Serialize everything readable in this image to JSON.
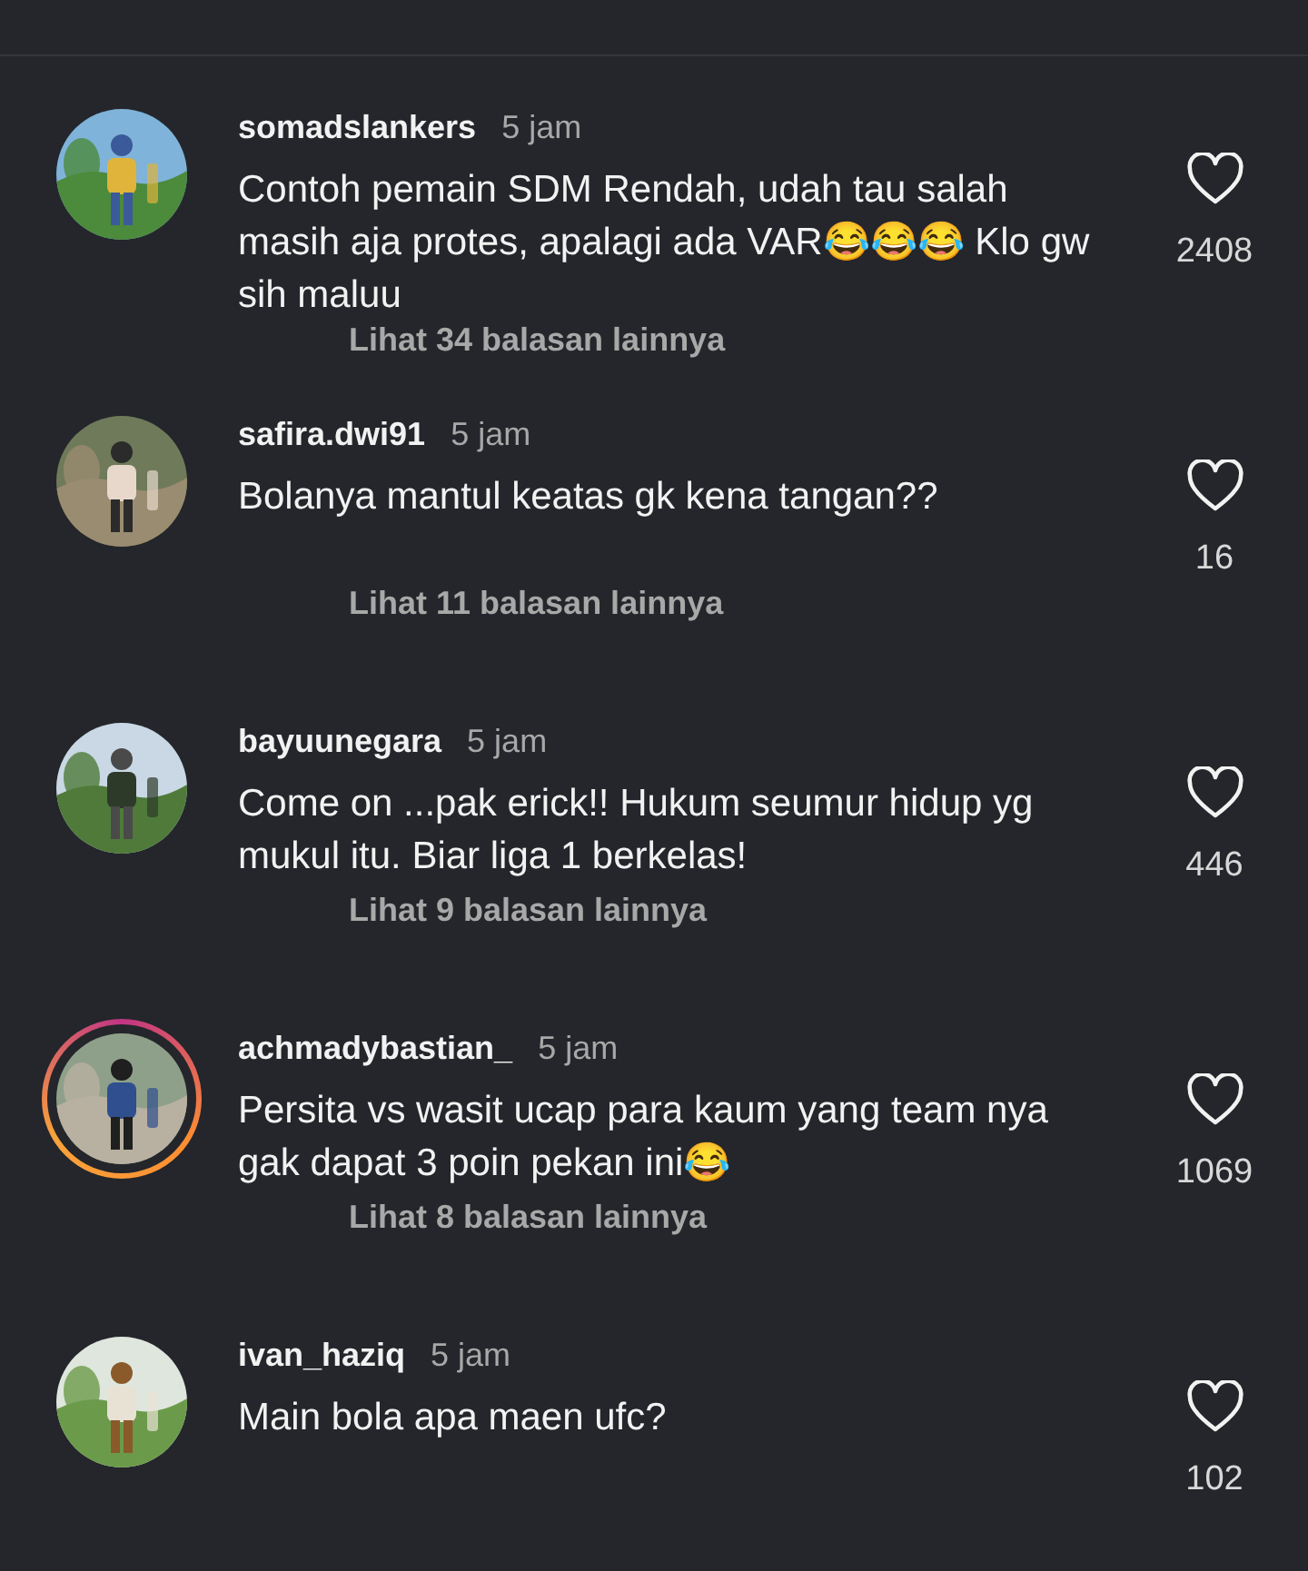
{
  "comments": [
    {
      "username": "somadslankers",
      "time": "5 jam",
      "text": "Contoh pemain SDM Rendah, udah tau salah masih aja protes, apalagi ada VAR😂😂😂 Klo gw sih maluu",
      "likes": "2408",
      "replies": "Lihat 34 balasan lainnya",
      "has_story": false
    },
    {
      "username": "safira.dwi91",
      "time": "5 jam",
      "text": "Bolanya mantul keatas gk kena tangan??",
      "likes": "16",
      "replies": "Lihat 11 balasan lainnya",
      "has_story": false
    },
    {
      "username": "bayuunegara",
      "time": "5 jam",
      "text": "Come on ...pak erick!! Hukum seumur hidup yg mukul itu. Biar liga 1 berkelas!",
      "likes": "446",
      "replies": "Lihat 9 balasan lainnya",
      "has_story": false
    },
    {
      "username": "achmadybastian_",
      "time": "5 jam",
      "text": "Persita vs wasit ucap para kaum yang team nya gak dapat 3 poin pekan ini😂",
      "likes": "1069",
      "replies": "Lihat 8 balasan lainnya",
      "has_story": true
    },
    {
      "username": "ivan_haziq",
      "time": "5 jam",
      "text": "Main bola apa maen ufc?",
      "likes": "102",
      "has_story": false
    }
  ]
}
